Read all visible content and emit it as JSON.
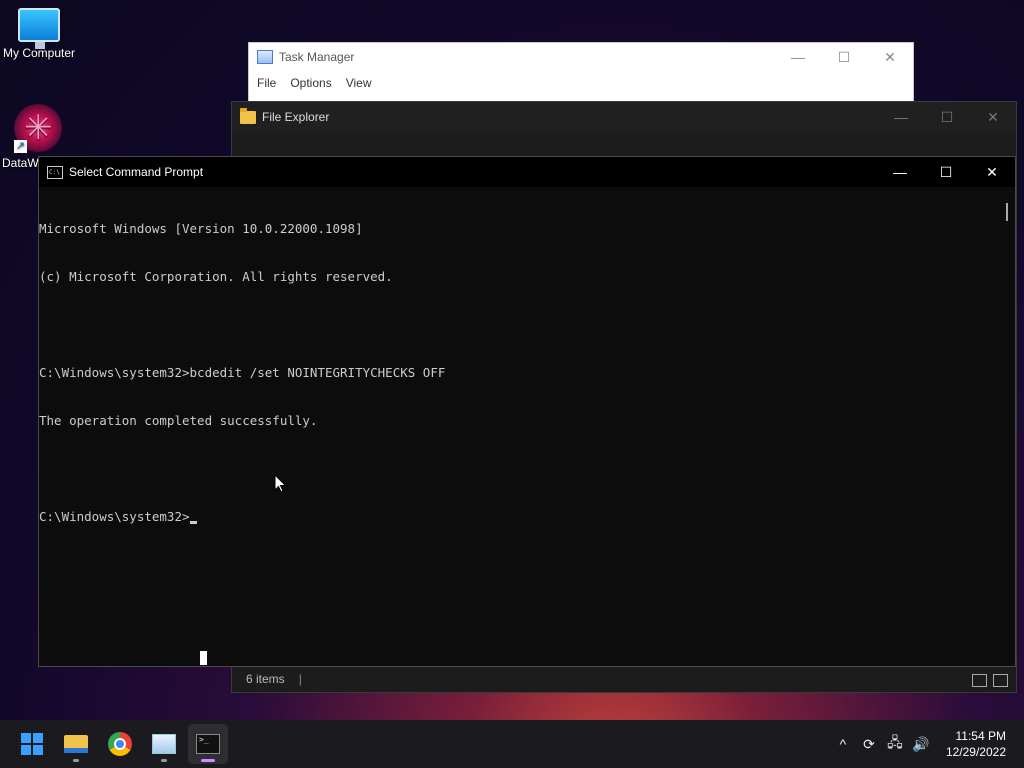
{
  "desktop": {
    "icons": [
      {
        "label": "My Computer"
      },
      {
        "label": "DataW"
      }
    ]
  },
  "task_manager": {
    "title": "Task Manager",
    "menu": [
      "File",
      "Options",
      "View"
    ],
    "controls": {
      "minimize": "—",
      "maximize": "☐",
      "close": "✕"
    }
  },
  "file_explorer": {
    "title": "File Explorer",
    "status": "6 items",
    "status_sep": "|",
    "controls": {
      "minimize": "—",
      "maximize": "☐",
      "close": "✕"
    }
  },
  "command_prompt": {
    "title": "Select Command Prompt",
    "controls": {
      "minimize": "—",
      "maximize": "☐",
      "close": "✕"
    },
    "lines": [
      "Microsoft Windows [Version 10.0.22000.1098]",
      "(c) Microsoft Corporation. All rights reserved.",
      "",
      "C:\\Windows\\system32>bcdedit /set NOINTEGRITYCHECKS OFF",
      "The operation completed successfully.",
      "",
      "C:\\Windows\\system32>"
    ]
  },
  "taskbar": {
    "apps": [
      "start-icon",
      "file-explorer-icon",
      "chrome-icon",
      "task-manager-icon",
      "terminal-icon"
    ],
    "tray": {
      "chevron": "^",
      "sync_icon": "⟳",
      "network_icon": "🖧",
      "volume_icon": "🔊",
      "time": "11:54 PM",
      "date": "12/29/2022"
    }
  }
}
